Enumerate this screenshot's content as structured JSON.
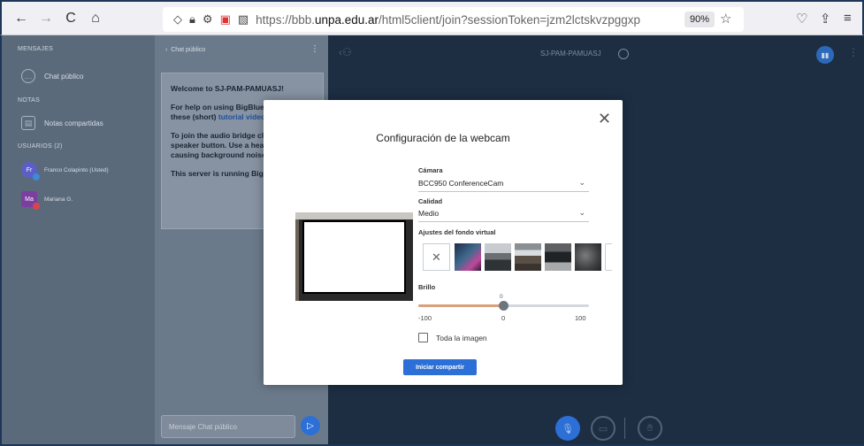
{
  "browser": {
    "back": "←",
    "forward": "→",
    "reload": "C",
    "home": "⌂",
    "url_scheme": "https://bbb.",
    "url_host": "unpa.edu.ar",
    "url_path": "/html5client/join?sessionToken=jzm2lctskvzpggxp",
    "zoom": "90%"
  },
  "sidebar": {
    "messages_heading": "MENSAJES",
    "public_chat": "Chat público",
    "notes_heading": "NOTAS",
    "shared_notes": "Notas compartidas",
    "users_heading": "USUARIOS (2)",
    "users": [
      {
        "initials": "Fr",
        "name": "Franco Colapinto (Usted)",
        "color": "#5b5fc7",
        "dot": "#3c8ad8"
      },
      {
        "initials": "Ma",
        "name": "Mariana G.",
        "color": "#7b3fa0",
        "dot": "#d9434f"
      }
    ]
  },
  "chat": {
    "header": "Chat público",
    "welcome_title": "Welcome to SJ-PAM-PAMUASJ!",
    "help_text": "For help on using BigBlueButton see these (short)",
    "help_link": "tutorial videos.",
    "audio_text": "To join the audio bridge click the speaker button. Use a headset to avoid causing background noise for others.",
    "server_text": "This server is running BigBlueButton.",
    "input_placeholder": "Mensaje Chat público"
  },
  "main": {
    "meeting_name": "SJ-PAM-PAMUASJ"
  },
  "modal": {
    "title": "Configuración de la webcam",
    "camera_label": "Cámara",
    "camera_value": "BCC950 ConferenceCam",
    "quality_label": "Calidad",
    "quality_value": "Medio",
    "bg_label": "Ajustes del fondo virtual",
    "brightness_label": "Brillo",
    "brightness_value": 0,
    "brightness_current": "0",
    "brightness_min": "-100",
    "brightness_mid": "0",
    "brightness_max": "100",
    "whole_image_label": "Toda la imagen",
    "whole_image_checked": false,
    "start_button": "Iniciar compartir"
  }
}
